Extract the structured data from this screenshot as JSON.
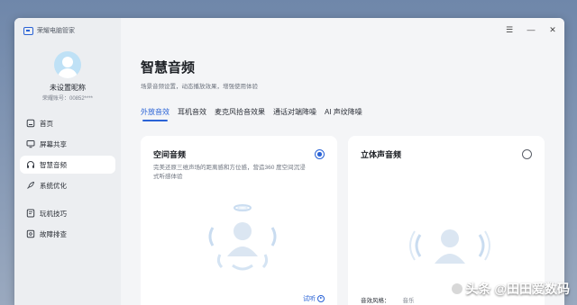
{
  "app": {
    "name": "荣耀电脑管家",
    "window_controls": {
      "menu": "☰",
      "minimize": "—",
      "close": "✕"
    }
  },
  "user": {
    "name": "未设置昵称",
    "account": "荣耀账号：00852****"
  },
  "sidebar": {
    "items": [
      {
        "label": "首页",
        "icon": "home-icon"
      },
      {
        "label": "屏幕共享",
        "icon": "screen-share-icon"
      },
      {
        "label": "智慧音频",
        "icon": "headphone-icon",
        "active": true
      },
      {
        "label": "系统优化",
        "icon": "rocket-icon"
      },
      {
        "label": "玩机技巧",
        "icon": "tips-icon"
      },
      {
        "label": "故障排查",
        "icon": "troubleshoot-icon"
      }
    ]
  },
  "main": {
    "title": "智慧音频",
    "subtitle": "场景音频设置，动态播放效果，增强使用体验",
    "tabs": [
      {
        "label": "外放音效",
        "active": true
      },
      {
        "label": "耳机音效"
      },
      {
        "label": "麦克风拾音效果"
      },
      {
        "label": "通话对端降噪"
      },
      {
        "label": "AI 声纹降噪"
      }
    ],
    "cards": {
      "spatial": {
        "title": "空间音频",
        "desc": "完美还原三维声场的距离感和方位感，营造360 度空间沉浸式听感体验",
        "selected": true,
        "listen_label": "试听"
      },
      "stereo": {
        "title": "立体声音频",
        "selected": false,
        "style_label": "音效风格：",
        "style_value": "音乐",
        "listen_label": "试听"
      }
    }
  },
  "watermark": "头条 @田田爱数码",
  "colors": {
    "accent": "#2a63d6",
    "sidebar_bg": "#eceef1",
    "main_bg": "#f4f5f7"
  }
}
